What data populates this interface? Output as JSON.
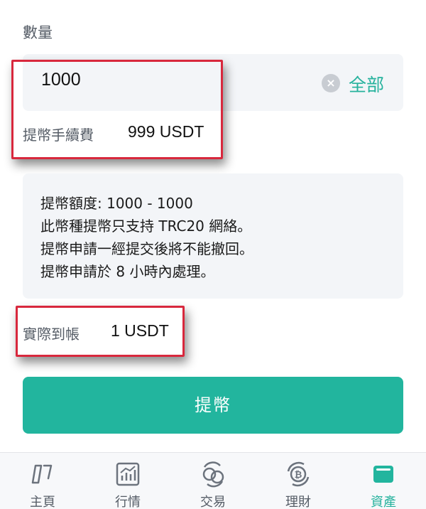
{
  "form": {
    "quantity_label": "數量",
    "amount_value": "1000",
    "all_label": "全部",
    "fee_label": "提幣手續費",
    "fee_value": "999 USDT",
    "info_lines": [
      "提幣額度: 1000 - 1000",
      "此幣種提幣只支持 TRC20 網絡。",
      "提幣申請一經提交後將不能撤回。",
      "提幣申請於 8 小時內處理。"
    ],
    "received_label": "實際到帳",
    "received_value": "1 USDT",
    "submit_label": "提幣"
  },
  "tabbar": {
    "items": [
      {
        "label": "主頁",
        "icon": "home-icon"
      },
      {
        "label": "行情",
        "icon": "market-chart-icon"
      },
      {
        "label": "交易",
        "icon": "trade-exchange-icon"
      },
      {
        "label": "理財",
        "icon": "bitcoin-finance-icon"
      },
      {
        "label": "資產",
        "icon": "wallet-icon"
      }
    ],
    "active_index": 4
  },
  "colors": {
    "accent": "#26b29d",
    "highlight_border": "#d8283d"
  }
}
